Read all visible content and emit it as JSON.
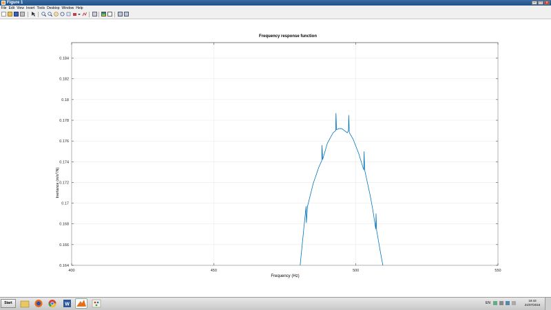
{
  "window": {
    "title": "Figure 1",
    "min_label": "–",
    "max_label": "□",
    "close_label": "x"
  },
  "menu": [
    "File",
    "Edit",
    "View",
    "Insert",
    "Tools",
    "Desktop",
    "Window",
    "Help"
  ],
  "toolbar_icons": [
    "new-figure-icon",
    "open-file-icon",
    "save-icon",
    "print-icon",
    "edit-plot-icon",
    "zoom-in-icon",
    "zoom-out-icon",
    "pan-icon",
    "rotate-icon",
    "data-cursor-icon",
    "brush-icon",
    "brush-dropdown-icon",
    "link-plot-icon",
    "colorbar-icon",
    "legend-icon",
    "hide-plot-tools-icon",
    "show-plot-tools-icon"
  ],
  "chart_data": {
    "type": "line",
    "title": "Frequency response function",
    "xlabel": "Frequency (Hz)",
    "ylabel_main": "Inertance (m/s",
    "ylabel_sup": "2",
    "ylabel_end": "/N)",
    "xlim": [
      400,
      550
    ],
    "ylim": [
      0.164,
      0.1855
    ],
    "xticks": [
      "400",
      "450",
      "500",
      "550"
    ],
    "yticks": [
      "0.164",
      "0.166",
      "0.168",
      "0.17",
      "0.172",
      "0.174",
      "0.176",
      "0.178",
      "0.18",
      "0.182",
      "0.184"
    ],
    "grid": true,
    "line_color": "#0072BD",
    "series": [
      {
        "x": [
          480.4,
          482.0,
          482.5,
          482.6,
          483.0,
          485.0,
          487.0,
          488.0,
          488.1,
          488.3,
          490.0,
          492.0,
          492.9,
          493.0,
          493.2,
          494.0,
          495.0,
          496.0,
          497.0,
          497.4,
          497.5,
          497.7,
          499.0,
          501.0,
          502.8,
          502.9,
          503.1,
          505.0,
          506.0,
          507.0,
          507.1,
          507.3,
          508.5,
          509.5
        ],
        "y": [
          0.164,
          0.1684,
          0.1697,
          0.1681,
          0.1697,
          0.1719,
          0.1735,
          0.1741,
          0.1756,
          0.1742,
          0.1758,
          0.1768,
          0.177,
          0.1787,
          0.1771,
          0.1772,
          0.1772,
          0.177,
          0.1768,
          0.177,
          0.1785,
          0.1768,
          0.1762,
          0.1748,
          0.1732,
          0.175,
          0.1732,
          0.1708,
          0.1693,
          0.1675,
          0.169,
          0.1674,
          0.1655,
          0.164
        ]
      }
    ]
  },
  "taskbar": {
    "start_label": "Start",
    "apps": [
      "file-explorer-icon",
      "firefox-icon",
      "chrome-icon",
      "word-icon",
      "matlab-icon",
      "paint-icon"
    ],
    "language": "EN",
    "time": "18:43",
    "date": "21/07/2015"
  }
}
